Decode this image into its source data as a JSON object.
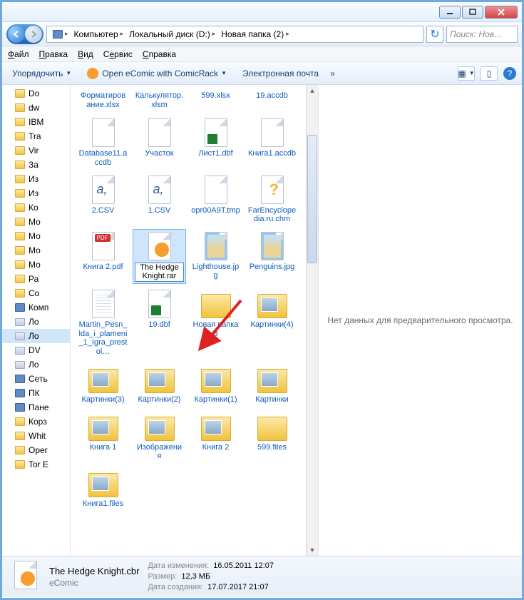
{
  "titlebar": {
    "min": "_",
    "max": "☐",
    "close": "✕"
  },
  "nav": {
    "crumbs": [
      "Компьютер",
      "Локальный диск (D:)",
      "Новая папка (2)"
    ],
    "search_placeholder": "Поиск: Нов…"
  },
  "menu": {
    "items": [
      "Файл",
      "Правка",
      "Вид",
      "Сервис",
      "Справка"
    ]
  },
  "toolbar": {
    "organize": "Упорядочить",
    "open_comic": "Open eComic with ComicRack",
    "email": "Электронная почта"
  },
  "sidebar": {
    "items": [
      {
        "t": "folder",
        "l": "Do"
      },
      {
        "t": "folder",
        "l": "dw"
      },
      {
        "t": "folder",
        "l": "IBM"
      },
      {
        "t": "folder",
        "l": "Tra"
      },
      {
        "t": "folder",
        "l": "Vir"
      },
      {
        "t": "folder",
        "l": "За"
      },
      {
        "t": "folder",
        "l": "Из"
      },
      {
        "t": "folder",
        "l": "Из"
      },
      {
        "t": "folder",
        "l": "Ко"
      },
      {
        "t": "folder",
        "l": "Мо"
      },
      {
        "t": "folder",
        "l": "Мо"
      },
      {
        "t": "folder",
        "l": "Мо"
      },
      {
        "t": "folder",
        "l": "Мо"
      },
      {
        "t": "folder",
        "l": "Ра"
      },
      {
        "t": "folder",
        "l": "Со"
      },
      {
        "t": "comp",
        "l": "Комп"
      },
      {
        "t": "drive",
        "l": "Ло"
      },
      {
        "t": "drive",
        "l": "Ло",
        "sel": true
      },
      {
        "t": "drive",
        "l": "DV"
      },
      {
        "t": "drive",
        "l": "Ло"
      },
      {
        "t": "comp",
        "l": "Сеть"
      },
      {
        "t": "comp",
        "l": "ПК"
      },
      {
        "t": "comp",
        "l": "Пане"
      },
      {
        "t": "folder",
        "l": "Корз"
      },
      {
        "t": "folder",
        "l": "Whit"
      },
      {
        "t": "folder",
        "l": "Oper"
      },
      {
        "t": "folder",
        "l": "Tor E"
      }
    ]
  },
  "files": {
    "row_top": [
      {
        "ico": "excel",
        "l": "Форматирование.xlsx"
      },
      {
        "ico": "excel",
        "l": "Калькулятор.xlsm"
      },
      {
        "ico": "excel",
        "l": "599.xlsx"
      },
      {
        "ico": "sheet",
        "l": "19.accdb"
      }
    ],
    "grid": [
      {
        "ico": "sheet",
        "l": "Database11.accdb"
      },
      {
        "ico": "sheet",
        "l": "Участок"
      },
      {
        "ico": "excel",
        "l": "Лист1.dbf"
      },
      {
        "ico": "sheet",
        "l": "Книга1.accdb"
      },
      {
        "ico": "csv",
        "l": "2.CSV"
      },
      {
        "ico": "csv",
        "l": "1.CSV"
      },
      {
        "ico": "sheet",
        "l": "opr00A9T.tmp"
      },
      {
        "ico": "help",
        "l": "FarEncyclopedia.ru.chm"
      },
      {
        "ico": "pdf",
        "l": "Книга 2.pdf"
      },
      {
        "ico": "cbr",
        "l": "The Hedge Knight.rar",
        "sel": true,
        "edit": true
      },
      {
        "ico": "img",
        "l": "Lighthouse.jpg"
      },
      {
        "ico": "img",
        "l": "Penguins.jpg"
      },
      {
        "ico": "txt",
        "l": "Martin_Pesn_lda_i_plameni_1_Igra_prestol…"
      },
      {
        "ico": "excel",
        "l": "19.dbf"
      },
      {
        "ico": "folder",
        "l": "Новая папка 3"
      },
      {
        "ico": "folderthumb",
        "l": "Картинки(4)"
      },
      {
        "ico": "folderthumb",
        "l": "Картинки(3)"
      },
      {
        "ico": "folderthumb",
        "l": "Картинки(2)"
      },
      {
        "ico": "folderthumb",
        "l": "Картинки(1)"
      },
      {
        "ico": "folderthumb",
        "l": "Картинки"
      },
      {
        "ico": "folderthumb",
        "l": "Книга 1"
      },
      {
        "ico": "folderthumb",
        "l": "Изображения"
      },
      {
        "ico": "folderthumb",
        "l": "Книга 2"
      },
      {
        "ico": "folder",
        "l": "599.files"
      },
      {
        "ico": "folderthumb",
        "l": "Книга1.files"
      }
    ]
  },
  "preview": {
    "empty": "Нет данных для предварительного просмотра."
  },
  "details": {
    "name": "The Hedge Knight.cbr",
    "type": "eComic",
    "modified_label": "Дата изменения:",
    "modified": "16.05.2011 12:07",
    "size_label": "Размер:",
    "size": "12,3 МБ",
    "created_label": "Дата создания:",
    "created": "17.07.2017 21:07"
  }
}
